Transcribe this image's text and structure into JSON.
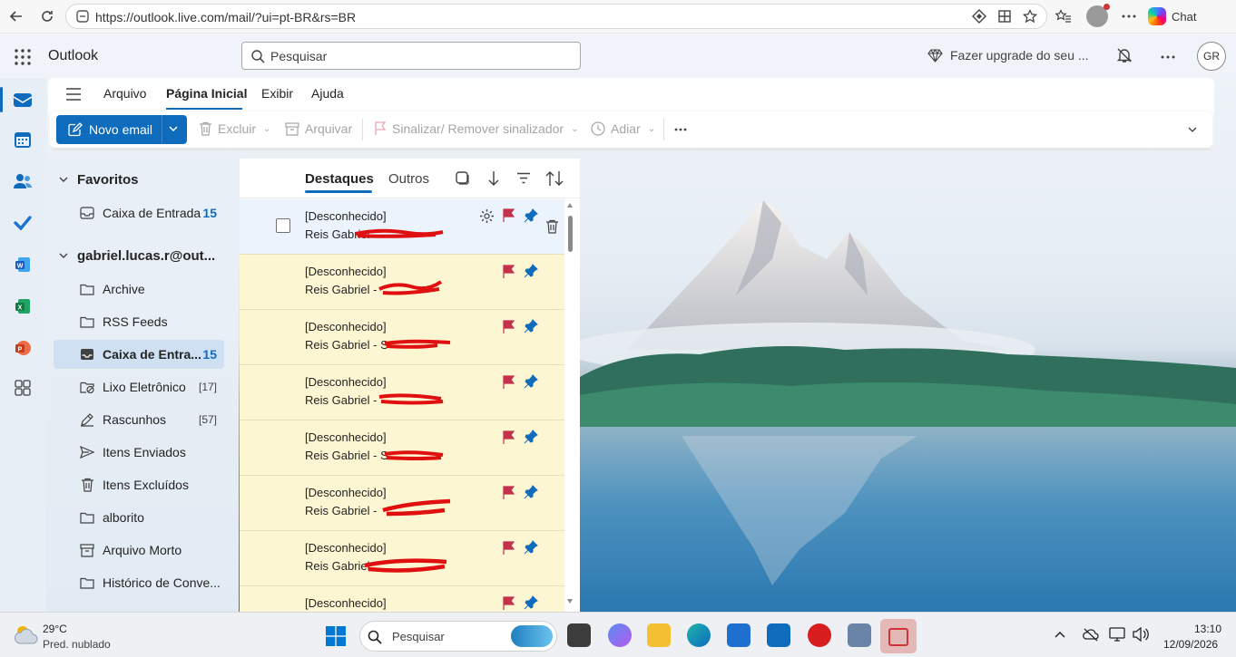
{
  "browser": {
    "url": "https://outlook.live.com/mail/?ui=pt-BR&rs=BR",
    "chat_label": "Chat"
  },
  "header": {
    "app_name": "Outlook",
    "search_placeholder": "Pesquisar",
    "upgrade_label": "Fazer upgrade do seu ...",
    "avatar_initials": "GR"
  },
  "ribbon": {
    "tabs": [
      "Arquivo",
      "Página Inicial",
      "Exibir",
      "Ajuda"
    ],
    "new_email": "Novo email",
    "delete": "Excluir",
    "archive": "Arquivar",
    "flag": "Sinalizar/ Remover sinalizador",
    "snooze": "Adiar"
  },
  "folders": {
    "favorites_title": "Favoritos",
    "favorites": [
      {
        "label": "Caixa de Entrada",
        "count": "15"
      }
    ],
    "account_title": "gabriel.lucas.r@out...",
    "items": [
      {
        "label": "Archive",
        "count": ""
      },
      {
        "label": "RSS Feeds",
        "count": ""
      },
      {
        "label": "Caixa de Entra...",
        "count": "15"
      },
      {
        "label": "Lixo Eletrônico",
        "count": "[17]"
      },
      {
        "label": "Rascunhos",
        "count": "[57]"
      },
      {
        "label": "Itens Enviados",
        "count": ""
      },
      {
        "label": "Itens Excluídos",
        "count": ""
      },
      {
        "label": "alborito",
        "count": ""
      },
      {
        "label": "Arquivo Morto",
        "count": ""
      },
      {
        "label": "Histórico de Conve...",
        "count": ""
      }
    ]
  },
  "message_list": {
    "tab_focused": "Destaques",
    "tab_other": "Outros",
    "messages": [
      {
        "sender": "[Desconhecido]",
        "subject": "Reis Gabriel"
      },
      {
        "sender": "[Desconhecido]",
        "subject": "Reis Gabriel - "
      },
      {
        "sender": "[Desconhecido]",
        "subject": "Reis Gabriel - S"
      },
      {
        "sender": "[Desconhecido]",
        "subject": "Reis Gabriel - "
      },
      {
        "sender": "[Desconhecido]",
        "subject": "Reis Gabriel - S"
      },
      {
        "sender": "[Desconhecido]",
        "subject": "Reis Gabriel - "
      },
      {
        "sender": "[Desconhecido]",
        "subject": "Reis Gabriel"
      },
      {
        "sender": "[Desconhecido]",
        "subject": ""
      }
    ]
  },
  "taskbar": {
    "weather_temp": "29°C",
    "weather_desc": "Pred. nublado",
    "search_placeholder": "Pesquisar",
    "time": "13:10",
    "date": "12/09/2026"
  },
  "colors": {
    "accent": "#0f6cbd",
    "flag_red": "#c4314b",
    "message_highlight": "#fdf6d2"
  }
}
